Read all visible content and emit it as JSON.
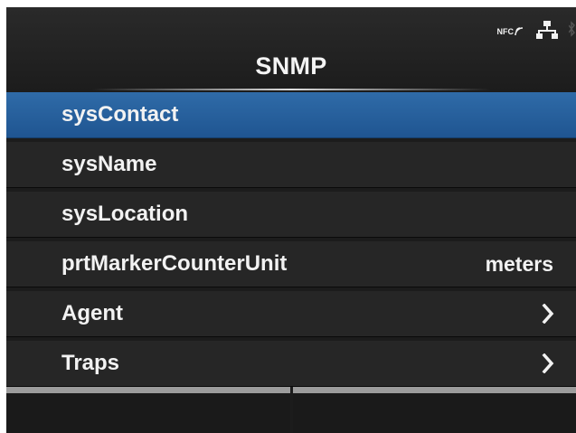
{
  "header": {
    "title": "SNMP",
    "status": {
      "nfc_label": "NFC"
    }
  },
  "menu": {
    "items": [
      {
        "label": "sysContact",
        "value": "",
        "selected": true
      },
      {
        "label": "sysName",
        "value": ""
      },
      {
        "label": "sysLocation",
        "value": ""
      },
      {
        "label": "prtMarkerCounterUnit",
        "value": "meters"
      },
      {
        "label": "Agent",
        "value": "",
        "icon": "chevron-right-icon"
      },
      {
        "label": "Traps",
        "value": "",
        "icon": "chevron-right-icon"
      }
    ]
  },
  "softkeys": {
    "left_label": "",
    "right_label": ""
  },
  "colors": {
    "selected_row": "#2a64a3",
    "row": "#262626",
    "background": "#1c1c1c",
    "text": "#f2f2f2"
  }
}
